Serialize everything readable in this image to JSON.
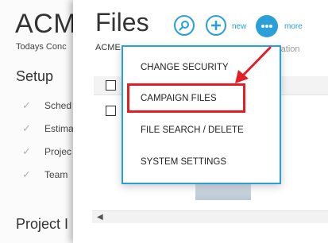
{
  "background": {
    "title": "ACM",
    "subtitle": "Todays Conc",
    "setup_heading": "Setup",
    "steps": [
      "Sched",
      "Estima",
      "Projec",
      "Team"
    ],
    "project_heading": "Project I"
  },
  "panel": {
    "title": "Files",
    "breadcrumb": "ACME",
    "faded_text": "ration",
    "buttons": {
      "search_icon": "search-icon",
      "new_label": "new",
      "more_label": "more"
    }
  },
  "menu": {
    "items": [
      "CHANGE SECURITY",
      "CAMPAIGN FILES",
      "FILE SEARCH / DELETE",
      "SYSTEM SETTINGS"
    ],
    "highlighted": "CAMPAIGN FILES"
  },
  "colors": {
    "accent": "#2a9fd8",
    "highlight": "#e41e24"
  }
}
